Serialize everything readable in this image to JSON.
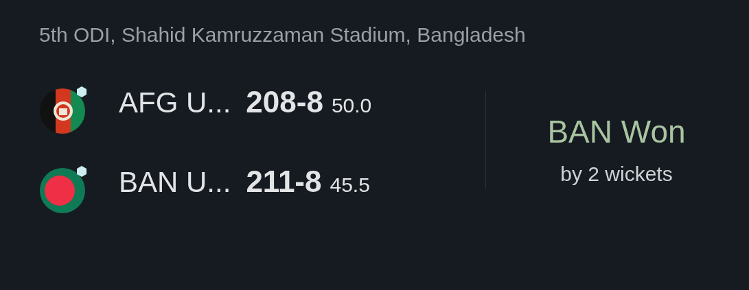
{
  "match_title": "5th ODI, Shahid Kamruzzaman Stadium, Bangladesh",
  "teams": [
    {
      "kind": "tricolor",
      "name": "AFG U...",
      "score": "208-8",
      "overs": "50.0"
    },
    {
      "kind": "disc",
      "name": "BAN U...",
      "score": "211-8",
      "overs": "45.5"
    }
  ],
  "result": {
    "headline": "BAN Won",
    "detail": "by 2 wickets"
  }
}
